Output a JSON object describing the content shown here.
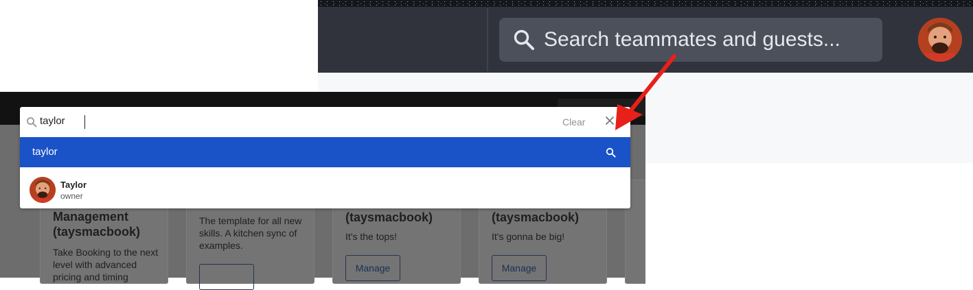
{
  "header": {
    "search_placeholder": "Search teammates and guests...",
    "search_icon": "search-icon",
    "avatar_icon": "user-avatar"
  },
  "dropdown": {
    "query": "taylor",
    "clear_label": "Clear",
    "close_icon": "close-icon",
    "highlight_label": "taylor",
    "result": {
      "name": "Taylor",
      "role": "owner"
    }
  },
  "background_cards": [
    {
      "title": "Management\n(taysmacbook)",
      "description": "Take Booking to the next level with advanced pricing and timing",
      "button": ""
    },
    {
      "title": "",
      "description": "The template for all new skills. A kitchen sync of examples.",
      "button": ""
    },
    {
      "title": "(taysmacbook)",
      "description": "It's the tops!",
      "button": "Manage"
    },
    {
      "title": "(taysmacbook)",
      "description": "It's gonna be big!",
      "button": "Manage"
    }
  ],
  "colors": {
    "highlight": "#1a52c8",
    "header_bg": "#30333c",
    "annotation_arrow": "#e8201a"
  }
}
